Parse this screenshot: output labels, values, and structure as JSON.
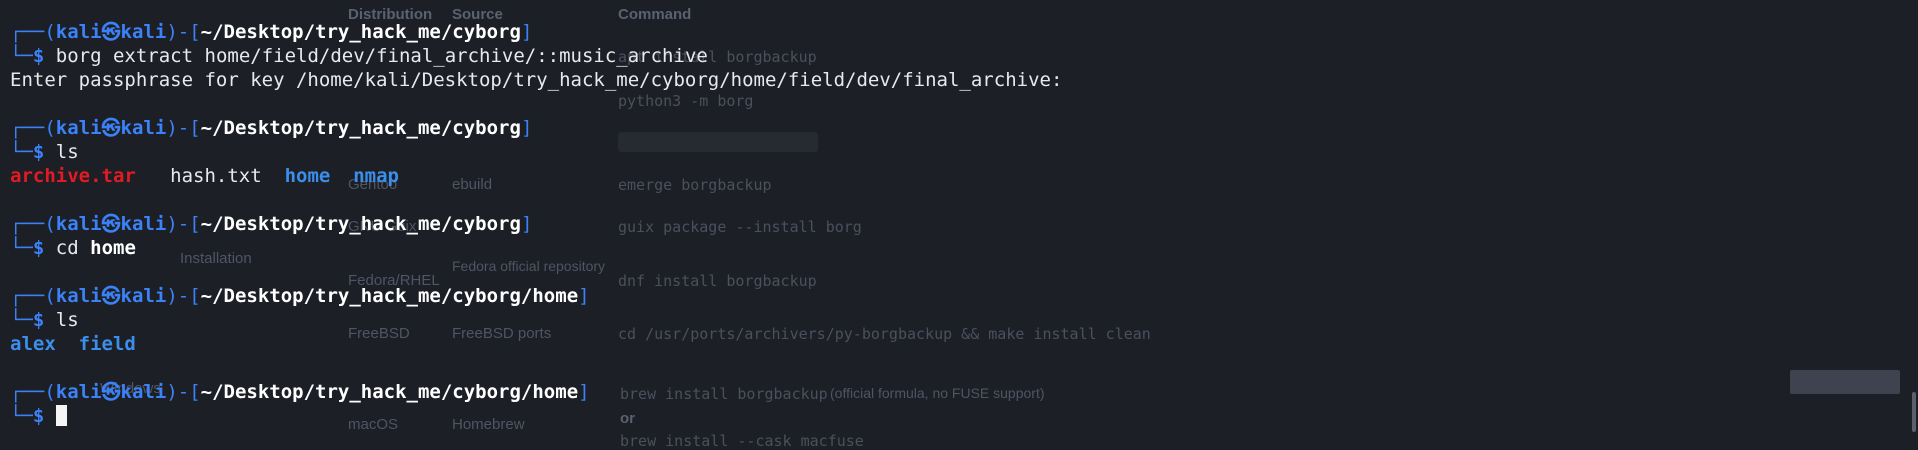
{
  "background_page": {
    "table_header": [
      "Distribution",
      "Source",
      "Command"
    ],
    "rows": [
      {
        "dist": "",
        "source": "",
        "cmd": "apt install borgbackup"
      },
      {
        "dist": "",
        "source": "",
        "cmd": "python3 -m borg"
      },
      {
        "dist": "Gentoo",
        "source": "ebuild",
        "cmd": "emerge borgbackup"
      },
      {
        "dist": "GNU Guix",
        "source": "",
        "cmd": "guix package --install borg"
      },
      {
        "dist": "Fedora/RHEL",
        "source": "Fedora official repository",
        "cmd": "dnf install borgbackup"
      },
      {
        "dist": "FreeBSD",
        "source": "FreeBSD ports",
        "cmd": "cd /usr/ports/archivers/py-borgbackup && make install clean"
      },
      {
        "dist": "macOS",
        "source": "Homebrew",
        "cmd": "brew install borgbackup"
      }
    ],
    "note_official": "(official formula, no FUSE support)",
    "or_label": "or",
    "cask_cmd": "brew install --cask macfuse",
    "sidebar_items": [
      "Installation",
      "Windows"
    ],
    "sidebar_active": "Installation"
  },
  "terminal": {
    "user": "kali",
    "host": "kali",
    "at_symbol": "㉿",
    "prompt_symbol": "$",
    "blocks": [
      {
        "path": "~/Desktop/try_hack_me/cyborg",
        "command": "borg extract home/field/dev/final_archive/::music_archive",
        "output_text": "Enter passphrase for key /home/kali/Desktop/try_hack_me/cyborg/home/field/dev/final_archive:"
      },
      {
        "path": "~/Desktop/try_hack_me/cyborg",
        "command": "ls",
        "ls_items": [
          "archive.tar",
          "hash.txt",
          "home",
          "nmap"
        ]
      },
      {
        "path": "~/Desktop/try_hack_me/cyborg",
        "command_verb": "cd",
        "command_arg": "home"
      },
      {
        "path": "~/Desktop/try_hack_me/cyborg/home",
        "command": "ls",
        "ls_items": [
          "alex",
          "field"
        ]
      },
      {
        "path": "~/Desktop/try_hack_me/cyborg/home",
        "command": ""
      }
    ]
  },
  "colors": {
    "background": "#1c1f26",
    "prompt_frame": "#3b82f6",
    "archive_color": "#e01b24",
    "dir_color": "#3b8eea"
  }
}
